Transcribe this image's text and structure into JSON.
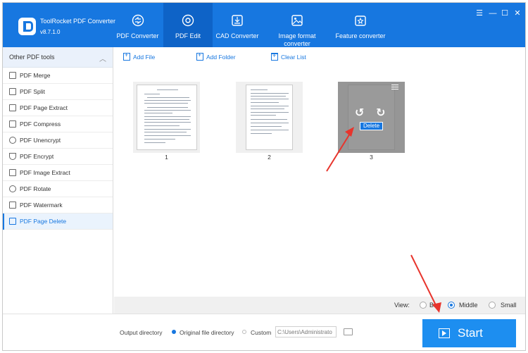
{
  "app": {
    "title": "ToolRocket PDF Converter",
    "version": "v8.7.1.0"
  },
  "nav": {
    "tabs": [
      {
        "label": "PDF Converter"
      },
      {
        "label": "PDF Edit"
      },
      {
        "label": "CAD Converter"
      },
      {
        "label": "Image format\nconverter"
      },
      {
        "label": "Feature converter"
      }
    ],
    "active": "PDF Edit"
  },
  "window": {
    "menu": "☰",
    "minimize": "—",
    "maximize": "☐",
    "close": "✕"
  },
  "sidebar": {
    "header": "Other PDF tools",
    "items": [
      {
        "label": "PDF Merge"
      },
      {
        "label": "PDF Split"
      },
      {
        "label": "PDF Page Extract"
      },
      {
        "label": "PDF Compress"
      },
      {
        "label": "PDF Unencrypt"
      },
      {
        "label": "PDF Encrypt"
      },
      {
        "label": "PDF Image Extract"
      },
      {
        "label": "PDF Rotate"
      },
      {
        "label": "PDF Watermark"
      },
      {
        "label": "PDF Page Delete"
      }
    ],
    "active": "PDF Page Delete"
  },
  "toolbar": {
    "add_file": "Add File",
    "add_folder": "Add Folder",
    "clear_list": "Clear List"
  },
  "pages": [
    {
      "number": "1"
    },
    {
      "number": "2"
    },
    {
      "number": "3",
      "hover_action": "Delete"
    }
  ],
  "view": {
    "label": "View:",
    "options": [
      "Big",
      "Middle",
      "Small"
    ],
    "selected": "Middle"
  },
  "output": {
    "label": "Output directory",
    "original": "Original file directory",
    "custom": "Custom",
    "path": "C:\\Users\\Administrato",
    "selected": "Original file directory"
  },
  "start_label": "Start",
  "colors": {
    "brand": "#1777e0",
    "start": "#1d8ef0",
    "annotation_arrow": "#e8342c"
  }
}
